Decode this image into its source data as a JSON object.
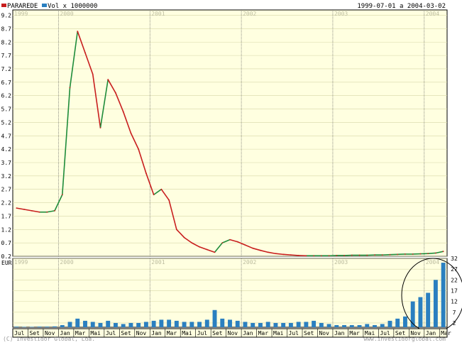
{
  "header": {
    "legend_ticker": "PARAREDE",
    "legend_volume": "Vol x 1000000",
    "date_range": "1999-07-01 a 2004-03-02"
  },
  "footer": {
    "copyright": "(C) Investidor Global, Lda.",
    "watermark": "www.investidorglobal.com"
  },
  "colors": {
    "panel_bg": "#ffffe0",
    "grid": "#d8d8a8",
    "year_line": "#606060",
    "up": "#1e8c3a",
    "down": "#c81e1e",
    "volume": "#2a7fc0",
    "annotation": "#000000"
  },
  "chart_data": [
    {
      "type": "line",
      "series": [
        {
          "name": "PARAREDE",
          "x": [
            "1999-07",
            "1999-08",
            "1999-09",
            "1999-10",
            "1999-11",
            "1999-12",
            "2000-01",
            "2000-02",
            "2000-03",
            "2000-04",
            "2000-05",
            "2000-06",
            "2000-07",
            "2000-08",
            "2000-09",
            "2000-10",
            "2000-11",
            "2000-12",
            "2001-01",
            "2001-02",
            "2001-03",
            "2001-04",
            "2001-05",
            "2001-06",
            "2001-07",
            "2001-08",
            "2001-09",
            "2001-10",
            "2001-11",
            "2001-12",
            "2002-01",
            "2002-02",
            "2002-03",
            "2002-04",
            "2002-05",
            "2002-06",
            "2002-07",
            "2002-08",
            "2002-09",
            "2002-10",
            "2002-11",
            "2002-12",
            "2003-01",
            "2003-02",
            "2003-03",
            "2003-04",
            "2003-05",
            "2003-06",
            "2003-07",
            "2003-08",
            "2003-09",
            "2003-10",
            "2003-11",
            "2003-12",
            "2004-01",
            "2004-02",
            "2004-03"
          ],
          "values": [
            2.0,
            1.95,
            1.9,
            1.85,
            1.85,
            1.9,
            2.5,
            6.5,
            8.6,
            7.8,
            7.0,
            5.0,
            6.8,
            6.3,
            5.6,
            4.8,
            4.2,
            3.3,
            2.5,
            2.7,
            2.3,
            1.2,
            0.9,
            0.7,
            0.55,
            0.45,
            0.35,
            0.7,
            0.82,
            0.74,
            0.62,
            0.5,
            0.42,
            0.35,
            0.3,
            0.27,
            0.25,
            0.23,
            0.22,
            0.22,
            0.22,
            0.22,
            0.23,
            0.23,
            0.24,
            0.24,
            0.24,
            0.25,
            0.25,
            0.26,
            0.27,
            0.28,
            0.28,
            0.29,
            0.3,
            0.32,
            0.38
          ]
        }
      ],
      "ylim": [
        0.2,
        9.4
      ],
      "y_ticks": [
        "9.2",
        "8.7",
        "8.2",
        "7.7",
        "7.2",
        "6.7",
        "6.2",
        "5.7",
        "5.2",
        "4.7",
        "4.2",
        "3.7",
        "3.2",
        "2.7",
        "2.2",
        "1.7",
        "1.2",
        "0.7",
        "0.2"
      ],
      "y_unit": "EUR",
      "year_labels": [
        "1999",
        "2000",
        "2001",
        "2002",
        "2003",
        "2004"
      ],
      "grid": true
    },
    {
      "type": "bar",
      "series": [
        {
          "name": "Vol",
          "x": [
            "1999-07",
            "1999-08",
            "1999-09",
            "1999-10",
            "1999-11",
            "1999-12",
            "2000-01",
            "2000-02",
            "2000-03",
            "2000-04",
            "2000-05",
            "2000-06",
            "2000-07",
            "2000-08",
            "2000-09",
            "2000-10",
            "2000-11",
            "2000-12",
            "2001-01",
            "2001-02",
            "2001-03",
            "2001-04",
            "2001-05",
            "2001-06",
            "2001-07",
            "2001-08",
            "2001-09",
            "2001-10",
            "2001-11",
            "2001-12",
            "2002-01",
            "2002-02",
            "2002-03",
            "2002-04",
            "2002-05",
            "2002-06",
            "2002-07",
            "2002-08",
            "2002-09",
            "2002-10",
            "2002-11",
            "2002-12",
            "2003-01",
            "2003-02",
            "2003-03",
            "2003-04",
            "2003-05",
            "2003-06",
            "2003-07",
            "2003-08",
            "2003-09",
            "2003-10",
            "2003-11",
            "2003-12",
            "2004-01",
            "2004-02",
            "2004-03"
          ],
          "values": [
            0.3,
            0.2,
            0.2,
            0.3,
            0.3,
            0.4,
            1.0,
            2.5,
            4.0,
            3.0,
            2.5,
            2.0,
            3.0,
            2.0,
            1.5,
            2.0,
            2.0,
            2.5,
            3.0,
            3.5,
            3.5,
            3.0,
            2.5,
            2.5,
            2.5,
            3.5,
            8.0,
            4.0,
            3.5,
            3.0,
            2.5,
            2.0,
            2.0,
            2.5,
            2.0,
            2.0,
            2.0,
            2.5,
            2.5,
            3.0,
            2.0,
            1.5,
            1.0,
            1.0,
            1.0,
            1.0,
            1.5,
            1.0,
            1.5,
            3.0,
            4.0,
            5.0,
            12.0,
            14.0,
            16.0,
            22.0,
            30.0
          ]
        }
      ],
      "ylim": [
        0,
        32
      ],
      "y_ticks": [
        "32",
        "27",
        "22",
        "17",
        "12",
        "7",
        "2"
      ],
      "x_month_labels": [
        "Jul",
        "Set",
        "Nov",
        "Jan",
        "Mar",
        "Mai",
        "Jul",
        "Set",
        "Nov",
        "Jan",
        "Mar",
        "Mai",
        "Jul",
        "Set",
        "Nov",
        "Jan",
        "Mar",
        "Mai",
        "Jul",
        "Set",
        "Nov",
        "Jan",
        "Mar",
        "Mai",
        "Jul",
        "Set",
        "Nov",
        "Jan",
        "Mar"
      ],
      "annotation": "circle around early-2004 volume spike"
    }
  ]
}
